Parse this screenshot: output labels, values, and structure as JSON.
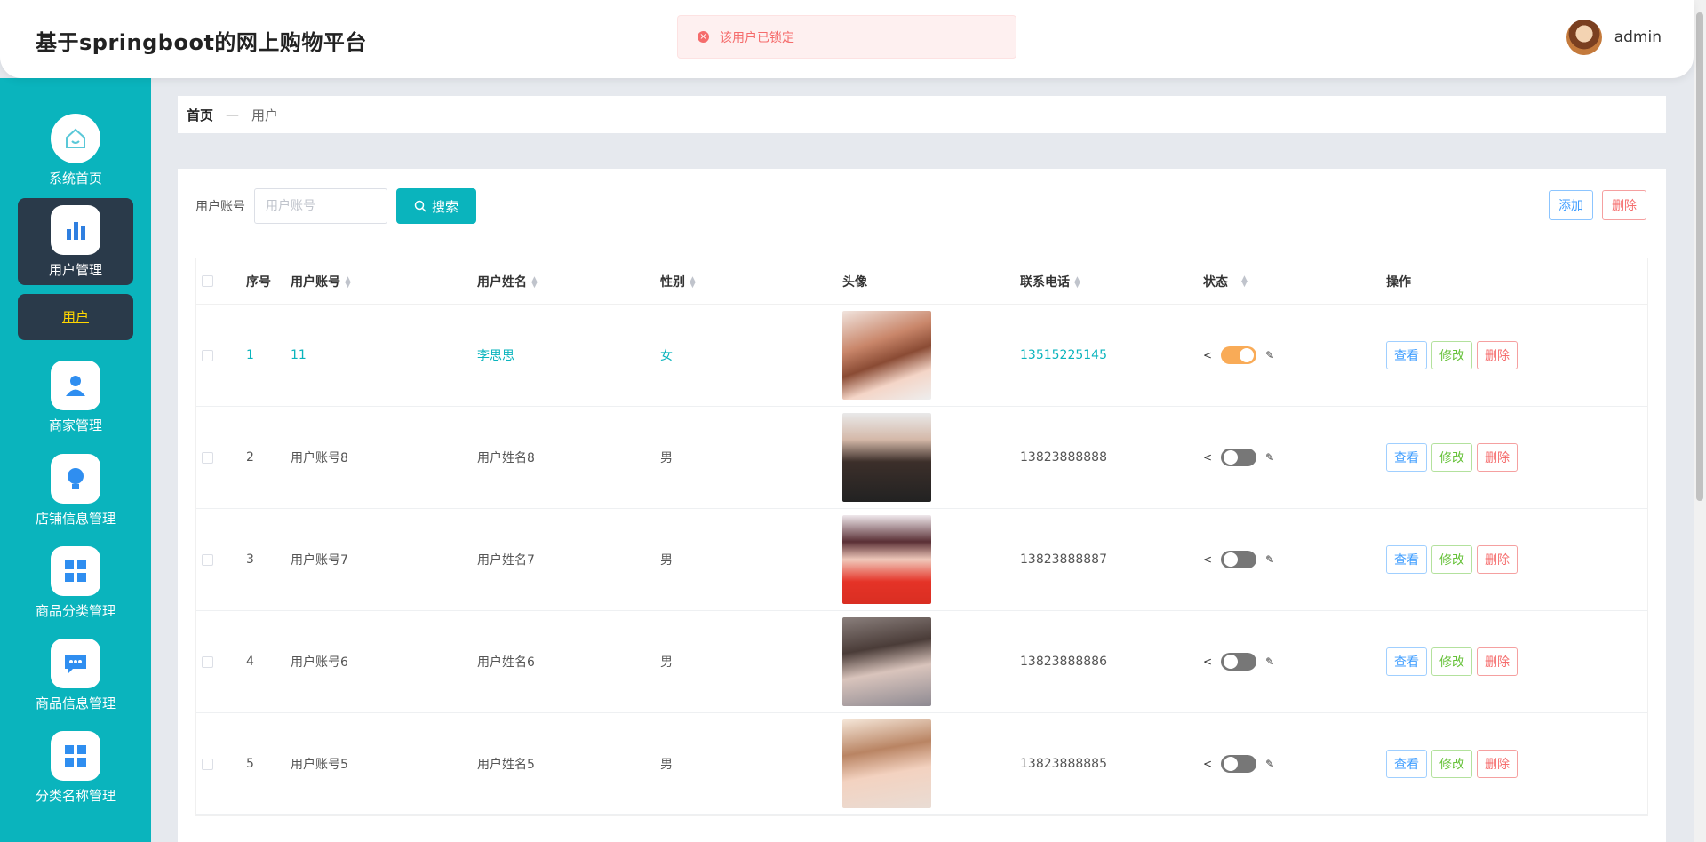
{
  "header": {
    "title": "基于springboot的网上购物平台",
    "username": "admin"
  },
  "toast": {
    "message": "该用户已锁定"
  },
  "sidebar": {
    "items": [
      {
        "label": "系统首页"
      },
      {
        "label": "用户管理"
      },
      {
        "label": "商家管理"
      },
      {
        "label": "店铺信息管理"
      },
      {
        "label": "商品分类管理"
      },
      {
        "label": "商品信息管理"
      },
      {
        "label": "分类名称管理"
      }
    ],
    "sub_item": "用户"
  },
  "breadcrumb": {
    "home": "首页",
    "separator": "—",
    "current": "用户"
  },
  "search": {
    "label": "用户账号",
    "placeholder": "用户账号",
    "button": "搜索"
  },
  "actions": {
    "add": "添加",
    "delete": "删除"
  },
  "table": {
    "headers": {
      "index": "序号",
      "account": "用户账号",
      "name": "用户姓名",
      "gender": "性别",
      "avatar": "头像",
      "phone": "联系电话",
      "status": "状态",
      "ops": "操作"
    },
    "op_labels": {
      "view": "查看",
      "edit": "修改",
      "delete": "删除"
    },
    "rows": [
      {
        "index": "1",
        "account": "11",
        "name": "李思思",
        "gender": "女",
        "phone": "13515225145",
        "status_on": true
      },
      {
        "index": "2",
        "account": "用户账号8",
        "name": "用户姓名8",
        "gender": "男",
        "phone": "13823888888",
        "status_on": false
      },
      {
        "index": "3",
        "account": "用户账号7",
        "name": "用户姓名7",
        "gender": "男",
        "phone": "13823888887",
        "status_on": false
      },
      {
        "index": "4",
        "account": "用户账号6",
        "name": "用户姓名6",
        "gender": "男",
        "phone": "13823888886",
        "status_on": false
      },
      {
        "index": "5",
        "account": "用户账号5",
        "name": "用户姓名5",
        "gender": "男",
        "phone": "13823888885",
        "status_on": false
      }
    ]
  },
  "colors": {
    "primary": "#0ab4bd",
    "sidebar_active": "#2a3a4a",
    "toggle_on": "#f9ab57",
    "danger": "#f56c6c"
  }
}
